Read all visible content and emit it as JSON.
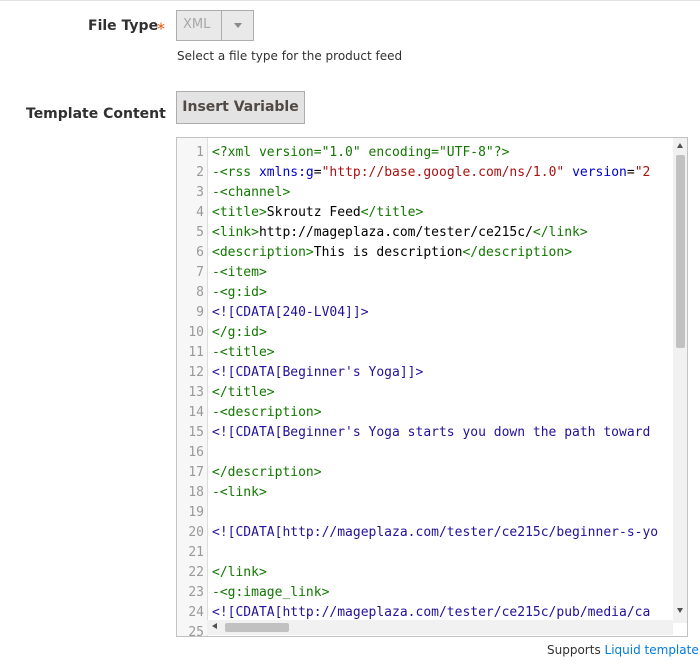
{
  "file_type": {
    "label": "File Type",
    "required_mark": "*",
    "value": "XML",
    "note": "Select a file type for the product feed"
  },
  "template": {
    "label": "Template Content",
    "insert_button": "Insert Variable",
    "support_text": "Supports",
    "support_link": "Liquid template"
  },
  "editor": {
    "lines": [
      {
        "n": "1",
        "segs": [
          {
            "c": "tag",
            "t": "<?xml version=\"1.0\" encoding=\"UTF-8\"?>"
          }
        ]
      },
      {
        "n": "2",
        "segs": [
          {
            "c": "tag",
            "t": "-<rss "
          },
          {
            "c": "attr",
            "t": "xmlns:g"
          },
          {
            "c": "",
            "t": "="
          },
          {
            "c": "str",
            "t": "\"http://base.google.com/ns/1.0\""
          },
          {
            "c": "",
            "t": " "
          },
          {
            "c": "attr",
            "t": "version"
          },
          {
            "c": "",
            "t": "="
          },
          {
            "c": "str",
            "t": "\"2"
          }
        ]
      },
      {
        "n": "3",
        "segs": [
          {
            "c": "tag",
            "t": "-<channel>"
          }
        ]
      },
      {
        "n": "4",
        "segs": [
          {
            "c": "tag",
            "t": "<title>"
          },
          {
            "c": "",
            "t": "Skroutz Feed"
          },
          {
            "c": "tag",
            "t": "</title>"
          }
        ]
      },
      {
        "n": "5",
        "segs": [
          {
            "c": "tag",
            "t": "<link>"
          },
          {
            "c": "",
            "t": "http://mageplaza.com/tester/ce215c/"
          },
          {
            "c": "tag",
            "t": "</link>"
          }
        ]
      },
      {
        "n": "6",
        "segs": [
          {
            "c": "tag",
            "t": "<description>"
          },
          {
            "c": "",
            "t": "This is description"
          },
          {
            "c": "tag",
            "t": "</description>"
          }
        ]
      },
      {
        "n": "7",
        "segs": [
          {
            "c": "tag",
            "t": "-<item>"
          }
        ]
      },
      {
        "n": "8",
        "segs": [
          {
            "c": "tag",
            "t": "-<g:id>"
          }
        ]
      },
      {
        "n": "9",
        "segs": [
          {
            "c": "cdata",
            "t": "<![CDATA[240-LV04]]>"
          }
        ]
      },
      {
        "n": "10",
        "segs": [
          {
            "c": "tag",
            "t": "</g:id>"
          }
        ]
      },
      {
        "n": "11",
        "segs": [
          {
            "c": "tag",
            "t": "-<title>"
          }
        ]
      },
      {
        "n": "12",
        "segs": [
          {
            "c": "cdata",
            "t": "<![CDATA[Beginner's Yoga]]>"
          }
        ]
      },
      {
        "n": "13",
        "segs": [
          {
            "c": "tag",
            "t": "</title>"
          }
        ]
      },
      {
        "n": "14",
        "segs": [
          {
            "c": "tag",
            "t": "-<description>"
          }
        ]
      },
      {
        "n": "15",
        "segs": [
          {
            "c": "cdata",
            "t": "<![CDATA[Beginner's Yoga starts you down the path toward"
          }
        ]
      },
      {
        "n": "16",
        "segs": []
      },
      {
        "n": "17",
        "segs": [
          {
            "c": "tag",
            "t": "</description>"
          }
        ]
      },
      {
        "n": "18",
        "segs": [
          {
            "c": "tag",
            "t": "-<link>"
          }
        ]
      },
      {
        "n": "19",
        "segs": []
      },
      {
        "n": "20",
        "segs": [
          {
            "c": "cdata",
            "t": "<![CDATA[http://mageplaza.com/tester/ce215c/beginner-s-yo"
          }
        ]
      },
      {
        "n": "21",
        "segs": []
      },
      {
        "n": "22",
        "segs": [
          {
            "c": "tag",
            "t": "</link>"
          }
        ]
      },
      {
        "n": "23",
        "segs": [
          {
            "c": "tag",
            "t": "-<g:image_link>"
          }
        ]
      },
      {
        "n": "24",
        "segs": [
          {
            "c": "cdata",
            "t": "<![CDATA[http://mageplaza.com/tester/ce215c/pub/media/ca"
          }
        ]
      },
      {
        "n": "25",
        "segs": []
      }
    ]
  }
}
